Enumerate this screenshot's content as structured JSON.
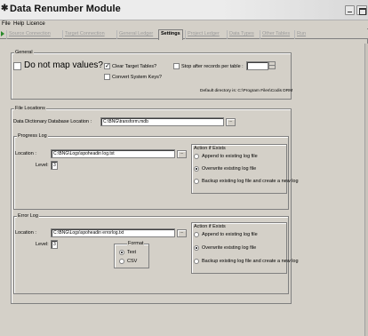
{
  "window": {
    "title": "Data Renumber Module",
    "icon": "app-icon"
  },
  "menu": [
    "File",
    "Help",
    "Licence"
  ],
  "tabs": [
    {
      "label": "Source Connection",
      "active": false
    },
    {
      "label": "Target Connection",
      "active": false
    },
    {
      "label": "General Ledger",
      "active": false
    },
    {
      "label": "Settings",
      "active": true
    },
    {
      "label": "Project Ledger",
      "active": false
    },
    {
      "label": "Data Types",
      "active": false
    },
    {
      "label": "Other Tables",
      "active": false
    },
    {
      "label": "Run",
      "active": false
    }
  ],
  "general": {
    "label": "General",
    "do_not_map": {
      "label": "Do not map values?",
      "checked": false
    },
    "clear_target": {
      "label": "Clear Target Tables?",
      "checked": true
    },
    "convert_system_keys": {
      "label": "Convert System Keys?",
      "checked": false
    },
    "stop_after": {
      "label": "Stop after records per table :",
      "checked": false,
      "value": ""
    },
    "default_directory": "Default directory is: C:\\Program Files\\Codis DRM"
  },
  "file_locations": {
    "label": "File Locations",
    "dd_location_label": "Data Dictionary Database Location :",
    "dd_location_value": "C:\\BNG\\transform.mdb",
    "browse_label": "..."
  },
  "progress_log": {
    "label": "Progress Log",
    "location_label": "Location :",
    "location_value": "C:\\BNG\\Logs\\spoheadin log.txt",
    "level_label": "Level:",
    "level_value": "3",
    "action_label": "Action if Exists",
    "options": [
      "Append to existing log file",
      "Overwrite existing log file",
      "Backup existing log file and create a new log"
    ],
    "selected": 1
  },
  "error_log": {
    "label": "Error Log",
    "location_label": "Location :",
    "location_value": "C:\\BNG\\Logs\\spoheadin errorlog.txt",
    "level_label": "Level:",
    "level_value": "3",
    "format_label": "Format",
    "format_options": [
      "Text",
      "CSV"
    ],
    "format_selected": 0,
    "action_label": "Action if Exists",
    "options": [
      "Append to existing log file",
      "Overwrite existing log file",
      "Backup existing log file and create a new log"
    ],
    "selected": 1
  }
}
